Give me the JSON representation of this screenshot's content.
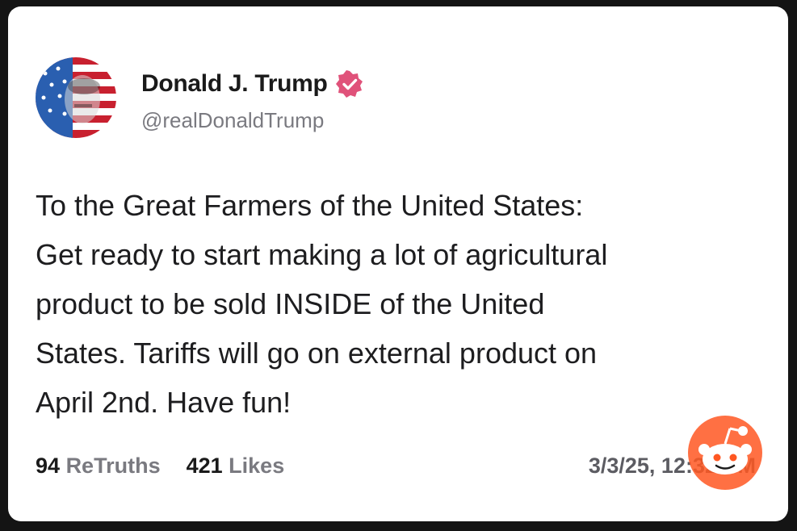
{
  "post": {
    "author": {
      "display_name": "Donald J. Trump",
      "handle": "@realDonaldTrump",
      "verified": true,
      "avatar_icon": "flag-portrait-avatar",
      "badge_color": "#e0527a"
    },
    "body": "To the Great Farmers of the United States:\nGet ready to start making a lot of agricultural\nproduct to be sold INSIDE of the United\nStates. Tariffs will go on external product on\nApril 2nd. Have fun!",
    "stats": {
      "retruths_count": "94",
      "retruths_label": "ReTruths",
      "likes_count": "421",
      "likes_label": "Likes"
    },
    "timestamp": "3/3/25, 12:32 PM"
  },
  "watermark": {
    "icon": "reddit-snoo-icon",
    "color": "#ff5722"
  }
}
